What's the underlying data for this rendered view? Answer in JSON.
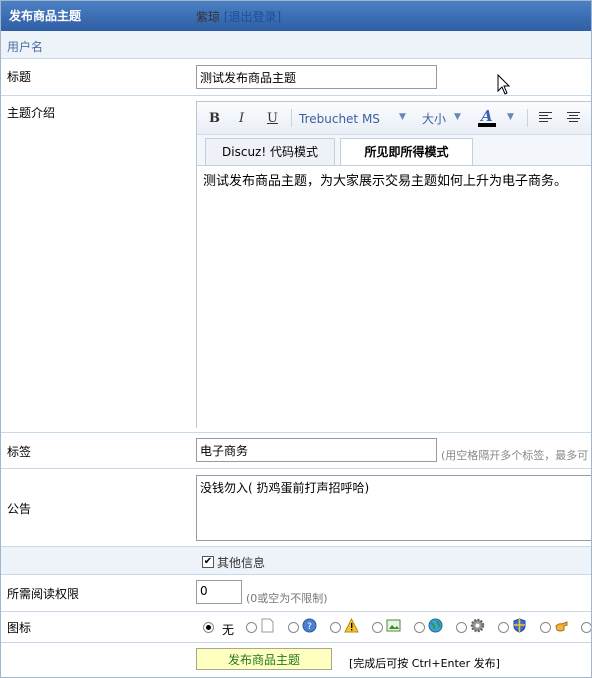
{
  "header": {
    "title": "发布商品主题"
  },
  "user": {
    "label": "用户名",
    "name": "紫琼",
    "logout": "[退出登录]"
  },
  "title_field": {
    "label": "标题",
    "value": "测试发布商品主题"
  },
  "intro": {
    "label": "主题介绍",
    "toolbar": {
      "bold": "B",
      "italic": "I",
      "underline": "U",
      "font": "Trebuchet MS",
      "size": "大小",
      "color_glyph": "A"
    },
    "tabs": [
      "Discuz! 代码模式",
      "所见即所得模式"
    ],
    "content": "测试发布商品主题，为大家展示交易主题如何上升为电子商务。"
  },
  "tags": {
    "label": "标签",
    "value": "电子商务",
    "hint": "(用空格隔开多个标签，最多可"
  },
  "notice": {
    "label": "公告",
    "value": "没钱勿入( 扔鸡蛋前打声招呼哈)"
  },
  "extra": {
    "label": "其他信息",
    "checked": true
  },
  "permission": {
    "label": "所需阅读权限",
    "value": "0",
    "hint": "(0或空为不限制)"
  },
  "icons": {
    "label": "图标",
    "none_label": "无",
    "items": [
      "blank-page-icon",
      "question-icon",
      "warning-icon",
      "picture-icon",
      "globe-icon",
      "gear-icon",
      "shield-icon",
      "hand-icon"
    ]
  },
  "submit": {
    "label": "发布商品主题",
    "hint": "[完成后可按 Ctrl+Enter 发布]"
  }
}
